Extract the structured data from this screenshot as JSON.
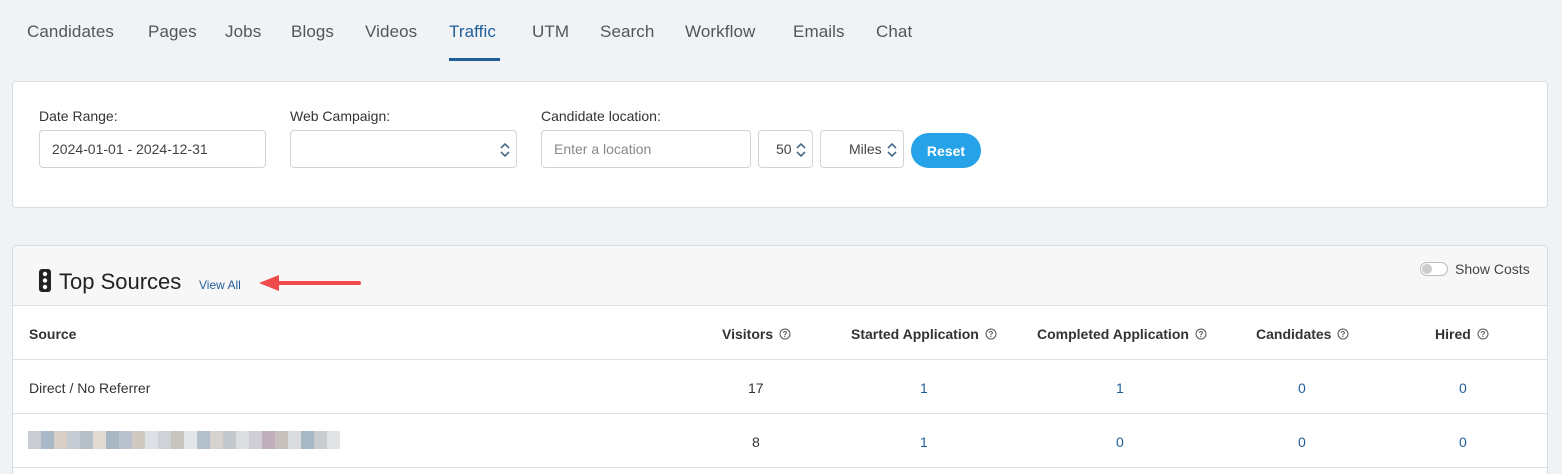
{
  "tabs": [
    {
      "label": "Candidates"
    },
    {
      "label": "Pages"
    },
    {
      "label": "Jobs"
    },
    {
      "label": "Blogs"
    },
    {
      "label": "Videos"
    },
    {
      "label": "Traffic"
    },
    {
      "label": "UTM"
    },
    {
      "label": "Search"
    },
    {
      "label": "Workflow"
    },
    {
      "label": "Emails"
    },
    {
      "label": "Chat"
    }
  ],
  "active_tab": "Traffic",
  "filters": {
    "date_range_label": "Date Range:",
    "date_range_value": "2024-01-01 - 2024-12-31",
    "web_campaign_label": "Web Campaign:",
    "web_campaign_value": "",
    "candidate_location_label": "Candidate location:",
    "location_placeholder": "Enter a location",
    "radius_value": "50",
    "unit_value": "Miles",
    "reset_label": "Reset"
  },
  "top_sources": {
    "title": "Top Sources",
    "view_all_label": "View All",
    "show_costs_label": "Show Costs",
    "columns": [
      "Source",
      "Visitors",
      "Started Application",
      "Completed Application",
      "Candidates",
      "Hired"
    ],
    "rows": [
      {
        "source": "Direct / No Referrer",
        "visitors": "17",
        "started": "1",
        "completed": "1",
        "candidates": "0",
        "hired": "0"
      },
      {
        "source": "",
        "visitors": "8",
        "started": "1",
        "completed": "0",
        "candidates": "0",
        "hired": "0"
      }
    ]
  },
  "colors": {
    "accent": "#1f5d99",
    "button": "#26a3e8",
    "annotation_arrow": "#f04a4a"
  }
}
